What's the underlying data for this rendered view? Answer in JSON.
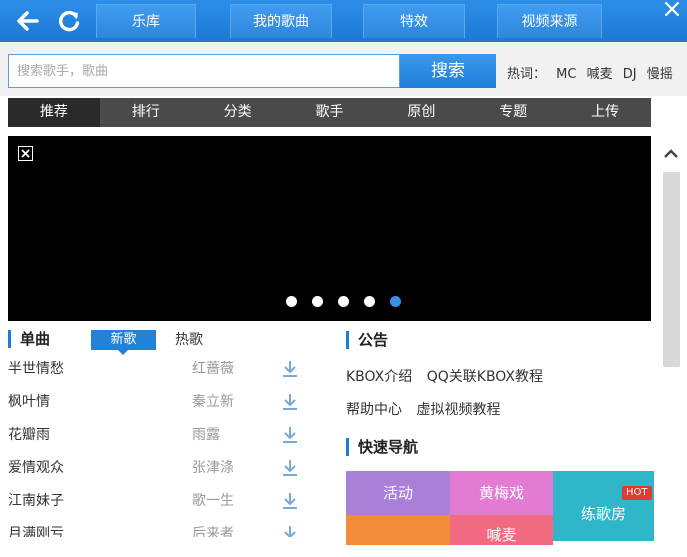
{
  "header": {
    "tabs": [
      {
        "label": "乐库",
        "active": true
      },
      {
        "label": "我的歌曲",
        "active": false
      },
      {
        "label": "特效",
        "active": false
      },
      {
        "label": "视频来源",
        "active": false
      }
    ]
  },
  "search": {
    "placeholder": "搜索歌手，歌曲",
    "value": "",
    "button_label": "搜索",
    "hot_label": "热词：",
    "hot_words": [
      "MC",
      "喊麦",
      "DJ",
      "慢摇"
    ]
  },
  "categories": [
    {
      "label": "推荐",
      "active": true
    },
    {
      "label": "排行",
      "active": false
    },
    {
      "label": "分类",
      "active": false
    },
    {
      "label": "歌手",
      "active": false
    },
    {
      "label": "原创",
      "active": false
    },
    {
      "label": "专题",
      "active": false
    },
    {
      "label": "上传",
      "active": false
    }
  ],
  "banner": {
    "slide_count": 5,
    "active_index": 4
  },
  "singles": {
    "title": "单曲",
    "tab_new": "新歌",
    "tab_hot": "热歌",
    "songs": [
      {
        "name": "半世情愁",
        "artist": "红蔷薇"
      },
      {
        "name": "枫叶情",
        "artist": "秦立新"
      },
      {
        "name": "花瓣雨",
        "artist": "雨露"
      },
      {
        "name": "爱情观众",
        "artist": "张津涤"
      },
      {
        "name": "江南妹子",
        "artist": "歌一生"
      },
      {
        "name": "月满刚亏",
        "artist": "后来者"
      }
    ]
  },
  "notice": {
    "title": "公告",
    "links_row1": [
      "KBOX介绍",
      "QQ关联KBOX教程"
    ],
    "links_row2": [
      "帮助中心",
      "虚拟视频教程"
    ]
  },
  "quick_nav": {
    "title": "快速导航",
    "tiles": {
      "activity": "活动",
      "huangmei": "黄梅戏",
      "practice": "练歌房",
      "hanmai": "喊麦"
    },
    "hot_badge": "HOT"
  },
  "colors": {
    "accent": "#1c7fd7",
    "top_bar": "#2d8ee8",
    "category_bar": "#4a4a4a"
  }
}
